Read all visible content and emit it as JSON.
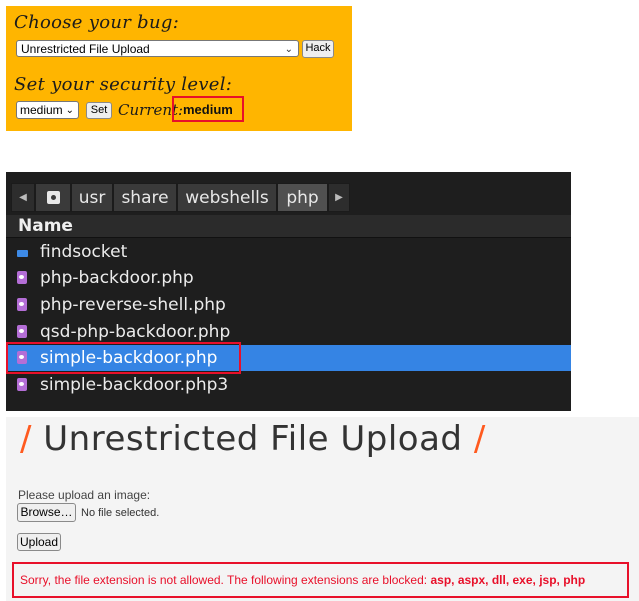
{
  "bwapp": {
    "choose_label": "Choose your bug:",
    "bug_selected": "Unrestricted File Upload",
    "hack_button": "Hack",
    "security_label": "Set your security level:",
    "level_selected": "medium",
    "set_button": "Set",
    "current_label": "Current:",
    "current_value": "medium"
  },
  "file_manager": {
    "breadcrumbs": [
      "usr",
      "share",
      "webshells",
      "php"
    ],
    "column_header": "Name",
    "items": [
      {
        "name": "findsocket",
        "type": "folder",
        "icon": "folder-icon"
      },
      {
        "name": "php-backdoor.php",
        "type": "php",
        "icon": "php-file-icon"
      },
      {
        "name": "php-reverse-shell.php",
        "type": "php",
        "icon": "php-file-icon"
      },
      {
        "name": "qsd-php-backdoor.php",
        "type": "php",
        "icon": "php-file-icon"
      },
      {
        "name": "simple-backdoor.php",
        "type": "php",
        "icon": "php-file-icon",
        "selected": true
      },
      {
        "name": "simple-backdoor.php3",
        "type": "php",
        "icon": "php-file-icon"
      }
    ]
  },
  "upload": {
    "title": "Unrestricted File Upload",
    "title_slash": "/",
    "prompt": "Please upload an image:",
    "browse_button": "Browse…",
    "no_file": "No file selected.",
    "upload_button": "Upload",
    "error_text": "Sorry, the file extension is not allowed. The following extensions are blocked:",
    "error_extensions": "asp, aspx, dll, exe, jsp, php"
  },
  "colors": {
    "bwapp_bg": "#ffb500",
    "selection": "#3584e4",
    "highlight": "#e8102a",
    "error": "#e8102a",
    "accent_slash": "#ff5a1f"
  }
}
